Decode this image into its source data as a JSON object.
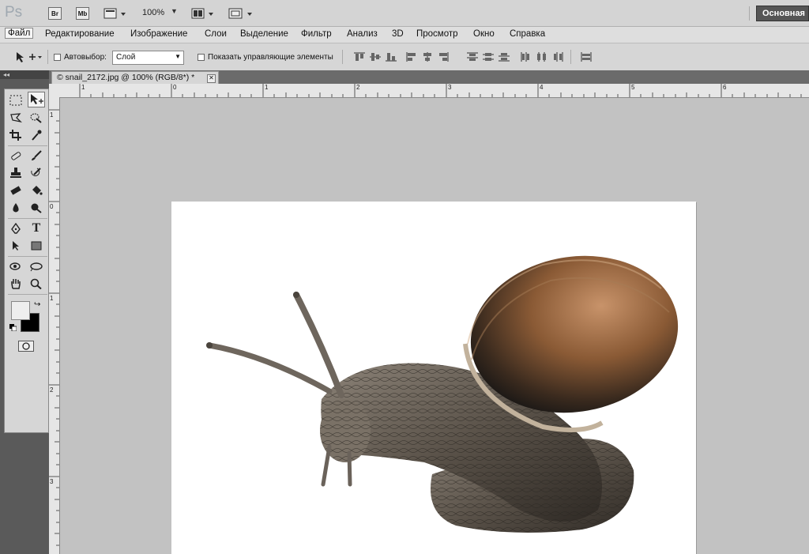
{
  "appbar": {
    "logo": "Ps",
    "bridge": "Br",
    "mini_bridge": "Mb",
    "zoom": "100%",
    "workspace": "Основная"
  },
  "menu": {
    "items": [
      "Файл",
      "Редактирование",
      "Изображение",
      "Слои",
      "Выделение",
      "Фильтр",
      "Анализ",
      "3D",
      "Просмотр",
      "Окно",
      "Справка"
    ]
  },
  "options": {
    "auto_select_label": "Автовыбор:",
    "auto_select_value": "Слой",
    "show_controls_label": "Показать управляющие элементы"
  },
  "document": {
    "tab_title": "© snail_2172.jpg @ 100% (RGB/8*) *"
  },
  "rulers": {
    "top": [
      "1",
      "0",
      "1",
      "2",
      "3",
      "4",
      "5",
      "6"
    ],
    "left": [
      "1",
      "0",
      "1",
      "2",
      "3"
    ]
  },
  "tools": {
    "collapse": "◂◂"
  },
  "colors": {
    "foreground": "#eeeeee",
    "background": "#000000",
    "accent": "#555555"
  }
}
